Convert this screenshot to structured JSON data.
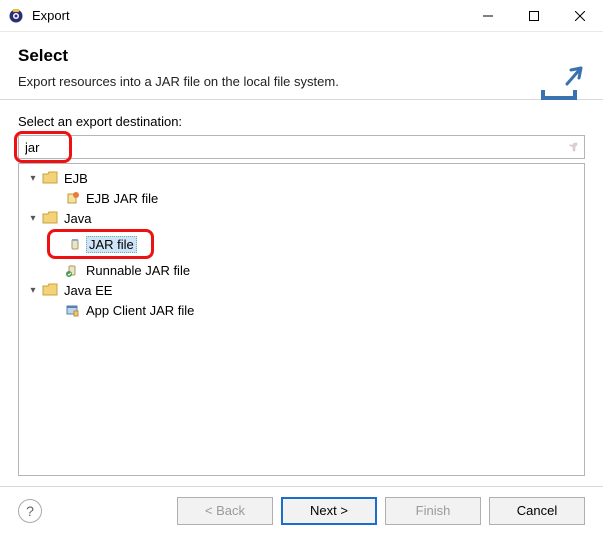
{
  "window": {
    "title": "Export"
  },
  "header": {
    "title": "Select",
    "subtitle": "Export resources into a JAR file on the local file system."
  },
  "body": {
    "label": "Select an export destination:",
    "search_value": "jar"
  },
  "tree": {
    "nodes": [
      {
        "label": "EJB",
        "expanded": true,
        "icon": "folder",
        "children": [
          {
            "label": "EJB JAR file",
            "icon": "ejb-jar"
          }
        ]
      },
      {
        "label": "Java",
        "expanded": true,
        "icon": "folder",
        "children": [
          {
            "label": "JAR file",
            "icon": "jar",
            "selected": true,
            "highlighted": true
          },
          {
            "label": "Runnable JAR file",
            "icon": "runnable-jar"
          }
        ]
      },
      {
        "label": "Java EE",
        "expanded": true,
        "icon": "folder",
        "children": [
          {
            "label": "App Client JAR file",
            "icon": "app-client"
          }
        ]
      }
    ]
  },
  "buttons": {
    "back": "< Back",
    "next": "Next >",
    "finish": "Finish",
    "cancel": "Cancel"
  }
}
